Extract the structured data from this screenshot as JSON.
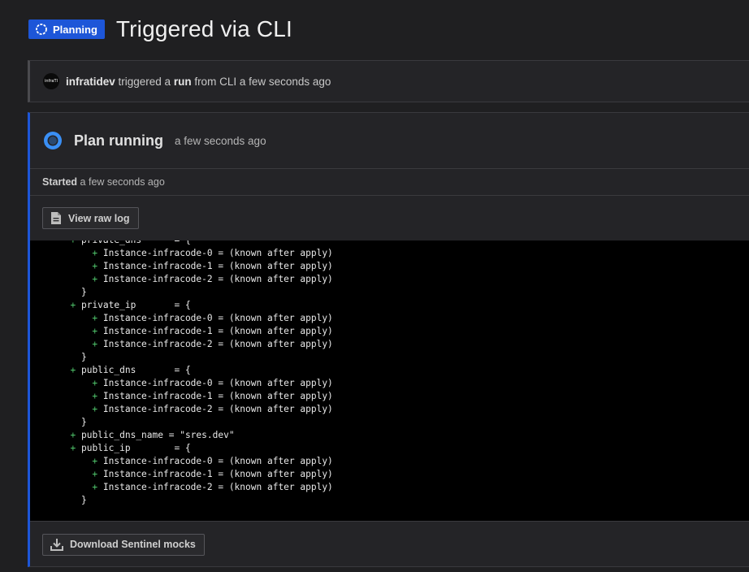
{
  "header": {
    "status_badge": "Planning",
    "title": "Triggered via CLI"
  },
  "trigger": {
    "avatar_text": "infraTI",
    "user": "infratidev",
    "text1": " triggered a ",
    "run": "run",
    "text2": " from CLI a few seconds ago"
  },
  "plan": {
    "title": "Plan running",
    "time": "a few seconds ago",
    "started_label": "Started",
    "started_time": " a few seconds ago",
    "view_raw_log": "View raw log",
    "download_mocks": "Download Sentinel mocks"
  },
  "log": {
    "lines": [
      {
        "indent": "  ",
        "plus": true,
        "text": "private_dns      = {"
      },
      {
        "indent": "      ",
        "plus": true,
        "text": "Instance-infracode-0 = (known after apply)"
      },
      {
        "indent": "      ",
        "plus": true,
        "text": "Instance-infracode-1 = (known after apply)"
      },
      {
        "indent": "      ",
        "plus": true,
        "text": "Instance-infracode-2 = (known after apply)"
      },
      {
        "indent": "    ",
        "plus": false,
        "text": "}"
      },
      {
        "indent": "  ",
        "plus": true,
        "text": "private_ip       = {"
      },
      {
        "indent": "      ",
        "plus": true,
        "text": "Instance-infracode-0 = (known after apply)"
      },
      {
        "indent": "      ",
        "plus": true,
        "text": "Instance-infracode-1 = (known after apply)"
      },
      {
        "indent": "      ",
        "plus": true,
        "text": "Instance-infracode-2 = (known after apply)"
      },
      {
        "indent": "    ",
        "plus": false,
        "text": "}"
      },
      {
        "indent": "  ",
        "plus": true,
        "text": "public_dns       = {"
      },
      {
        "indent": "      ",
        "plus": true,
        "text": "Instance-infracode-0 = (known after apply)"
      },
      {
        "indent": "      ",
        "plus": true,
        "text": "Instance-infracode-1 = (known after apply)"
      },
      {
        "indent": "      ",
        "plus": true,
        "text": "Instance-infracode-2 = (known after apply)"
      },
      {
        "indent": "    ",
        "plus": false,
        "text": "}"
      },
      {
        "indent": "  ",
        "plus": true,
        "text": "public_dns_name = \"sres.dev\""
      },
      {
        "indent": "  ",
        "plus": true,
        "text": "public_ip        = {"
      },
      {
        "indent": "      ",
        "plus": true,
        "text": "Instance-infracode-0 = (known after apply)"
      },
      {
        "indent": "      ",
        "plus": true,
        "text": "Instance-infracode-1 = (known after apply)"
      },
      {
        "indent": "      ",
        "plus": true,
        "text": "Instance-infracode-2 = (known after apply)"
      },
      {
        "indent": "    ",
        "plus": false,
        "text": "}"
      }
    ]
  },
  "colors": {
    "badge": "#1d56d8",
    "plus": "#4fc46b",
    "accent_border": "#1d56d8"
  },
  "icons": {
    "badge": "spinner-icon",
    "plan": "running-circle-icon",
    "view_raw_log": "document-icon",
    "download": "download-icon"
  }
}
